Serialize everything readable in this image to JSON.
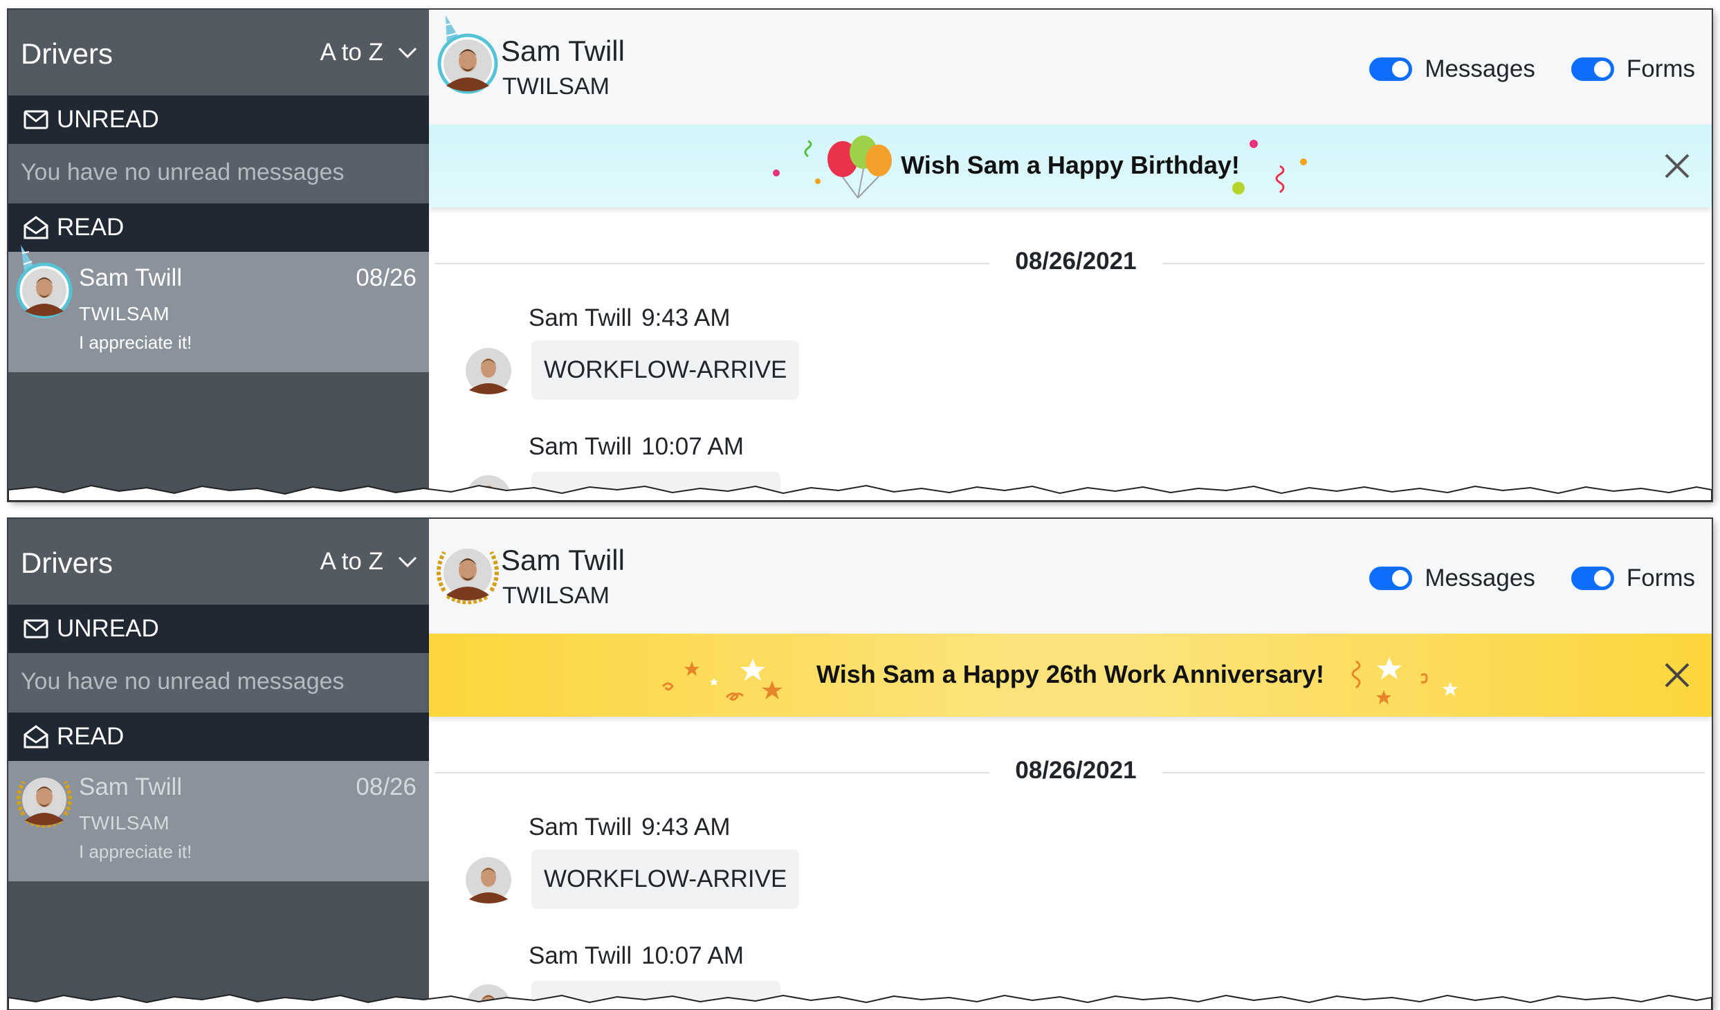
{
  "panels": [
    {
      "sidebar": {
        "title": "Drivers",
        "sort_label": "A to Z",
        "unread_label": "UNREAD",
        "unread_empty": "You have no unread messages",
        "read_label": "READ",
        "conversation": {
          "name": "Sam Twill",
          "date": "08/26",
          "id": "TWILSAM",
          "preview": "I appreciate it!"
        }
      },
      "header": {
        "name": "Sam Twill",
        "id": "TWILSAM",
        "messages_label": "Messages",
        "forms_label": "Forms"
      },
      "banner": {
        "text": "Wish Sam a Happy Birthday!",
        "theme": "birthday"
      },
      "date_separator": "08/26/2021",
      "messages": [
        {
          "sender": "Sam Twill",
          "time": "9:43 AM",
          "text": "WORKFLOW-ARRIVE"
        },
        {
          "sender": "Sam Twill",
          "time": "10:07 AM",
          "text": ""
        }
      ]
    },
    {
      "sidebar": {
        "title": "Drivers",
        "sort_label": "A to Z",
        "unread_label": "UNREAD",
        "unread_empty": "You have no unread messages",
        "read_label": "READ",
        "conversation": {
          "name": "Sam Twill",
          "date": "08/26",
          "id": "TWILSAM",
          "preview": "I appreciate it!"
        }
      },
      "header": {
        "name": "Sam Twill",
        "id": "TWILSAM",
        "messages_label": "Messages",
        "forms_label": "Forms"
      },
      "banner": {
        "text": "Wish Sam a Happy 26th Work Anniversary!",
        "theme": "anniversary"
      },
      "date_separator": "08/26/2021",
      "messages": [
        {
          "sender": "Sam Twill",
          "time": "9:43 AM",
          "text": "WORKFLOW-ARRIVE"
        },
        {
          "sender": "Sam Twill",
          "time": "10:07 AM",
          "text": ""
        }
      ]
    }
  ],
  "colors": {
    "toggle_on": "#0d6efd",
    "sidebar_dark": "#202833",
    "sidebar_bg": "#4a5058",
    "selected_row": "#8a929b",
    "birthday_banner": "#d2f5fa",
    "anniversary_banner": "#fbd63c"
  }
}
